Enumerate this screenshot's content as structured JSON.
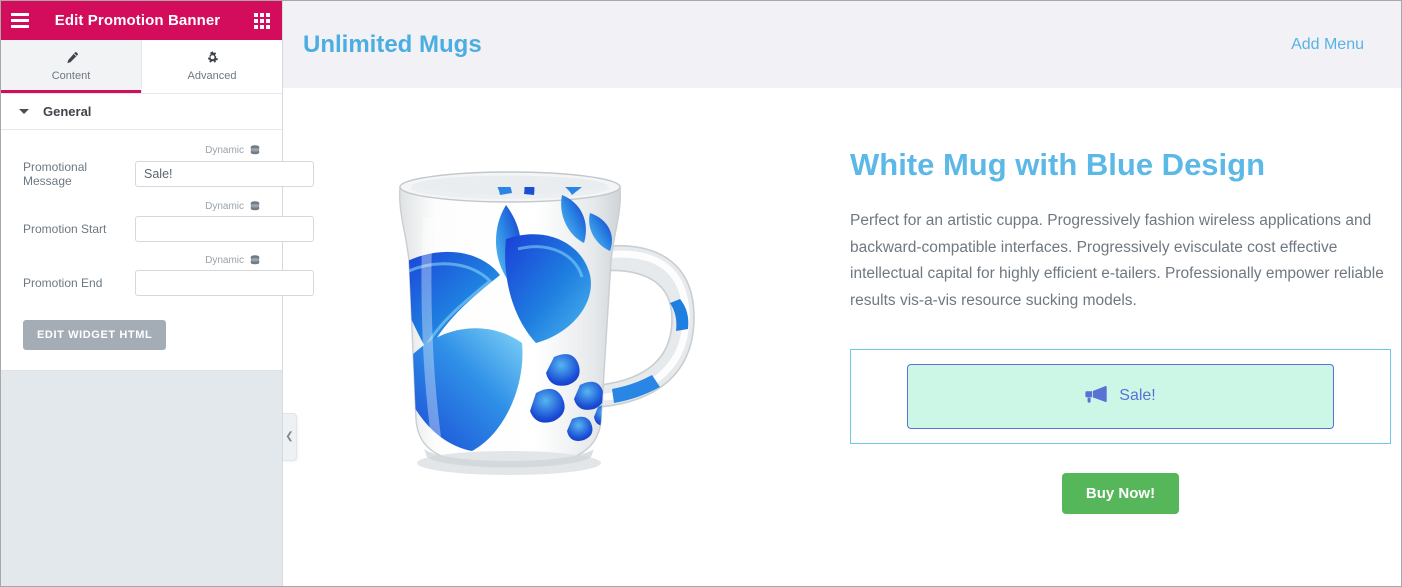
{
  "panel": {
    "header": {
      "title": "Edit Promotion Banner",
      "menu_icon": "hamburger-icon",
      "apps_icon": "grid-apps-icon"
    },
    "tabs": [
      {
        "label": "Content",
        "icon": "pencil-icon",
        "active": true
      },
      {
        "label": "Advanced",
        "icon": "gear-icon",
        "active": false
      }
    ],
    "section": {
      "title": "General",
      "collapse_icon": "caret-down-icon",
      "fields": [
        {
          "dynamic_label": "Dynamic",
          "dynamic_icon": "database-icon",
          "label": "Promotional Message",
          "value": "Sale!",
          "placeholder": ""
        },
        {
          "dynamic_label": "Dynamic",
          "dynamic_icon": "database-icon",
          "label": "Promotion Start",
          "value": "",
          "placeholder": ""
        },
        {
          "dynamic_label": "Dynamic",
          "dynamic_icon": "database-icon",
          "label": "Promotion End",
          "value": "",
          "placeholder": ""
        }
      ],
      "edit_html_button": "EDIT WIDGET HTML"
    },
    "collapse_tab_icon": "chevron-left-icon"
  },
  "canvas": {
    "site_header": {
      "site_title": "Unlimited Mugs",
      "add_menu": "Add Menu"
    },
    "product": {
      "image_alt": "white-mug-with-blue-floral-design",
      "title": "White Mug with Blue Design",
      "description": "Perfect for an artistic cuppa. Progressively fashion wireless applications and backward-compatible interfaces. Progressively evisculate cost effective intellectual capital for highly efficient e-tailers. Professionally empower reliable results vis-a-vis resource sucking models.",
      "promo": {
        "icon": "megaphone-icon",
        "text": "Sale!"
      },
      "buy_button": "Buy Now!"
    }
  },
  "colors": {
    "panel_header_pink": "#d30c5c",
    "tab_active_underline": "#d30c5c",
    "site_title_blue": "#4caee0",
    "product_title_blue": "#5cb8e6",
    "promo_bg_mint": "#ccf7e6",
    "promo_border_blue": "#5a72d6",
    "promo_outer_border": "#6ec6e8",
    "buy_button_green": "#56b65a",
    "edit_html_button_gray": "#a4adb6",
    "panel_bg": "#e3e8ec",
    "site_header_bg": "#f2f2f6"
  }
}
